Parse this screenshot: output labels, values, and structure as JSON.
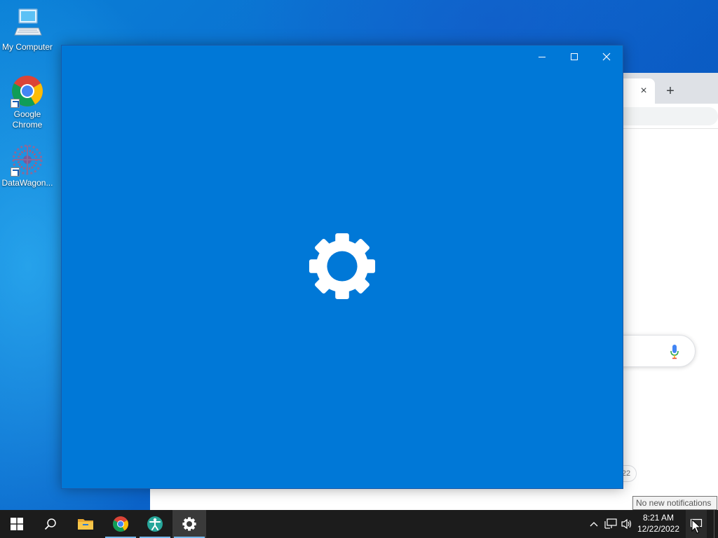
{
  "desktop": {
    "icons": [
      {
        "label": "My Computer",
        "icon": "computer-icon"
      },
      {
        "label": "Google Chrome",
        "icon": "chrome-icon"
      },
      {
        "label": "DataWagon...",
        "icon": "datawagon-icon"
      }
    ]
  },
  "chrome_window": {
    "tab_close_label": "×",
    "new_tab_label": "+",
    "footer_snippet": "22"
  },
  "settings_window": {
    "app": "Settings",
    "controls": [
      "minimize",
      "maximize",
      "close"
    ],
    "splash_icon": "gear-icon",
    "background_color": "#0078d7"
  },
  "taskbar": {
    "buttons": [
      {
        "name": "start",
        "icon": "windows-logo-icon"
      },
      {
        "name": "search",
        "icon": "search-icon"
      },
      {
        "name": "file-explorer",
        "icon": "folder-icon"
      },
      {
        "name": "chrome",
        "icon": "chrome-icon"
      },
      {
        "name": "accessibility-app",
        "icon": "person-icon"
      },
      {
        "name": "settings",
        "icon": "gear-icon"
      }
    ],
    "tray": {
      "chevron": "^",
      "time": "8:21 AM",
      "date": "12/22/2022"
    }
  },
  "tooltip": {
    "text": "No new notifications"
  }
}
